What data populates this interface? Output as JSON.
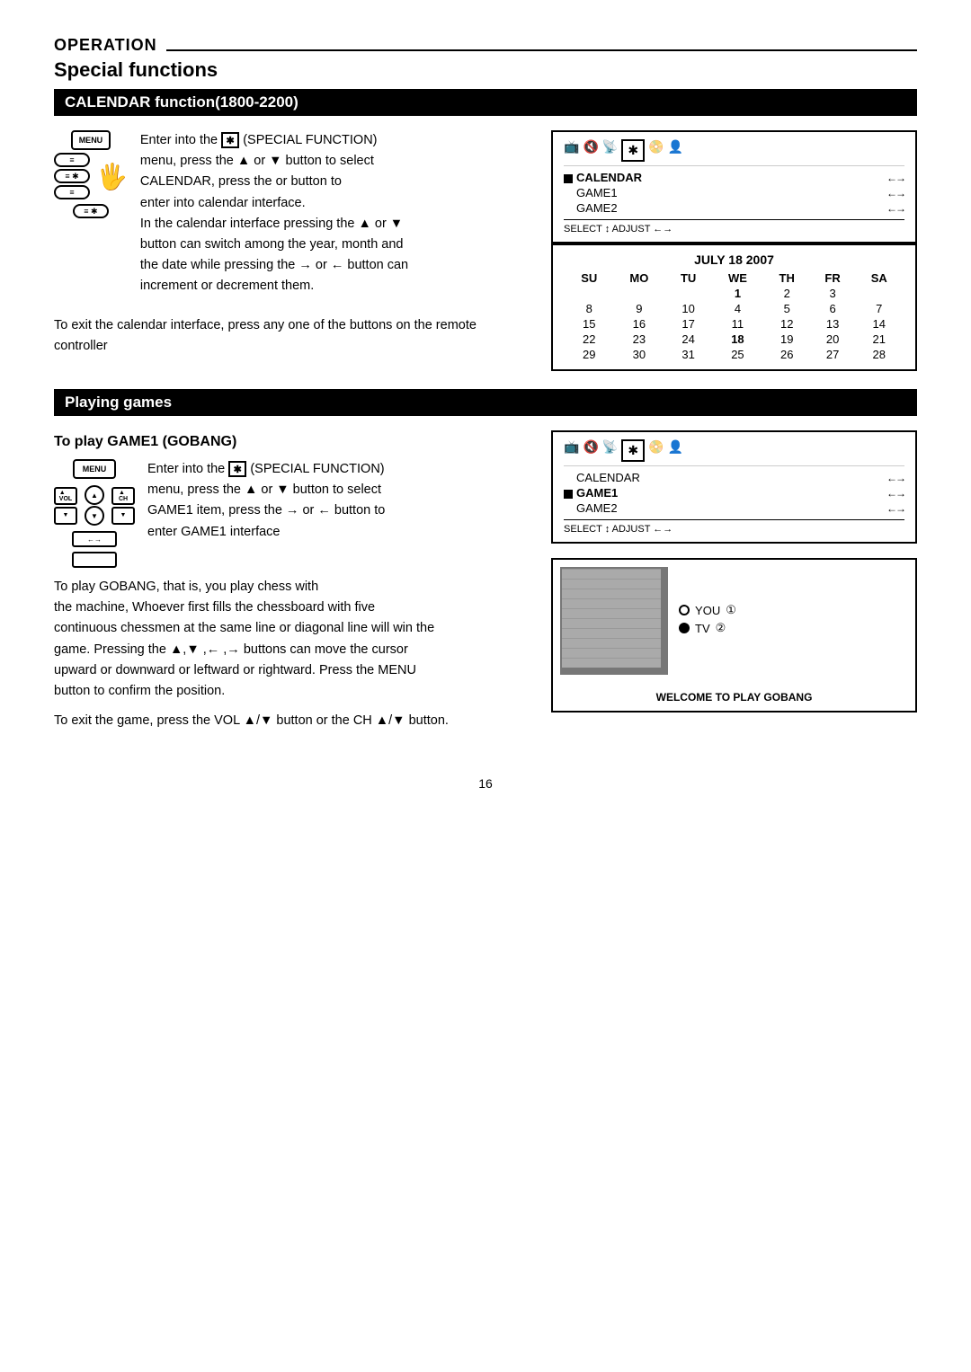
{
  "page": {
    "operation_label": "OPERATION",
    "special_functions_label": "Special functions",
    "calendar_section_title": "CALENDAR function(1800-2200)",
    "playing_games_title": "Playing games",
    "page_number": "16"
  },
  "calendar_section": {
    "instruction1": "Enter into the",
    "instruction1b": "(SPECIAL FUNCTION)",
    "instruction2": "menu, press the ▲ or ▼ button to select",
    "instruction3": "CALENDAR, press the  or  button to",
    "instruction4": "enter into calendar interface.",
    "instruction5": "In the calendar interface pressing the ▲ or ▼",
    "instruction6": "button can switch among the year, month and",
    "instruction7": "the date while pressing the → or ← button can",
    "instruction8": "increment or decrement them.",
    "exit_text": "To exit the calendar interface, press any one of the buttons on the remote controller",
    "osd_menu": {
      "top_icons": [
        "📺",
        "🔇",
        "📡",
        "🎵",
        "📀",
        "👤"
      ],
      "rows": [
        {
          "label": "CALENDAR",
          "arrows": "←→",
          "selected": true
        },
        {
          "label": "GAME1",
          "arrows": "←→",
          "selected": false
        },
        {
          "label": "GAME2",
          "arrows": "←→",
          "selected": false
        }
      ],
      "bottom": "SELECT ↕ ADJUST ←→"
    },
    "calendar_display": {
      "title": "JULY 18 2007",
      "headers": [
        "SU",
        "MO",
        "TU",
        "WE",
        "TH",
        "FR",
        "SA"
      ],
      "rows": [
        [
          "",
          "",
          "",
          "1",
          "2",
          "3",
          ""
        ],
        [
          "8",
          "9",
          "10",
          "4",
          "5",
          "6",
          "7"
        ],
        [
          "15",
          "16",
          "17",
          "11",
          "12",
          "13",
          "14"
        ],
        [
          "22",
          "23",
          "24",
          "18",
          "19",
          "20",
          "21"
        ],
        [
          "29",
          "30",
          "31",
          "25",
          "26",
          "27",
          "28"
        ]
      ]
    }
  },
  "games_section": {
    "subsection_title": "To  play GAME1 (GOBANG)",
    "instruction1": "Enter into the",
    "instruction1b": "(SPECIAL FUNCTION)",
    "instruction2": "menu, press the ▲ or ▼ button to select",
    "instruction3": "GAME1 item, press the → or ← button to",
    "instruction4": "enter GAME1 interface",
    "gobang_text1": "To play GOBANG, that is, you play chess with",
    "gobang_text2": "the machine, Whoever first fills the chessboard with five",
    "gobang_text3": "continuous chessmen at the same line or diagonal line will win the",
    "gobang_text4": "game. Pressing the ▲,▼ ,← ,→  buttons can move the cursor",
    "gobang_text5": "upward or downward or leftward or rightward. Press the MENU",
    "gobang_text6": "button to confirm the position.",
    "exit_text": "To exit the game, press the VOL ▲/▼ button or the CH ▲/▼ button.",
    "osd_menu": {
      "rows": [
        {
          "label": "CALENDAR",
          "arrows": "←→",
          "selected": false
        },
        {
          "label": "GAME1",
          "arrows": "←→",
          "selected": true
        },
        {
          "label": "GAME2",
          "arrows": "←→",
          "selected": false
        }
      ],
      "bottom": "SELECT ↕ ADJUST ←→"
    },
    "gobang_display": {
      "you_label": "YOU",
      "tv_label": "TV",
      "welcome": "WELCOME TO PLAY GOBANG"
    }
  }
}
